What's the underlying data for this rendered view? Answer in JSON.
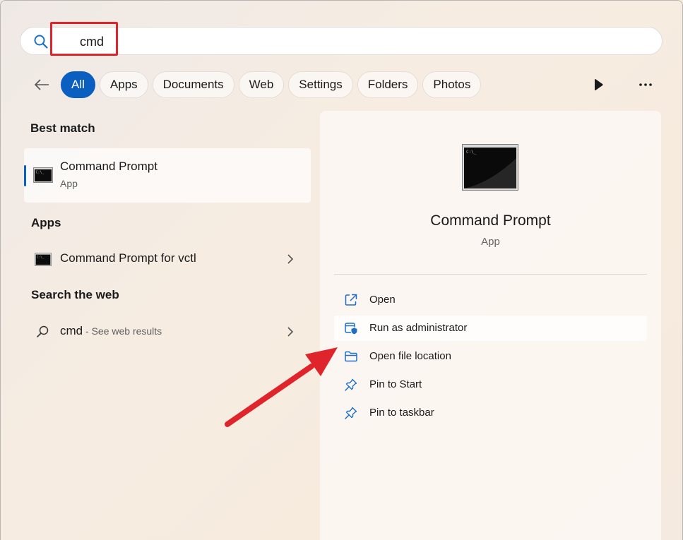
{
  "search": {
    "value": "cmd",
    "placeholder": ""
  },
  "filters": [
    {
      "label": "All",
      "active": true
    },
    {
      "label": "Apps",
      "active": false
    },
    {
      "label": "Documents",
      "active": false
    },
    {
      "label": "Web",
      "active": false
    },
    {
      "label": "Settings",
      "active": false
    },
    {
      "label": "Folders",
      "active": false
    },
    {
      "label": "Photos",
      "active": false
    }
  ],
  "best_match": {
    "heading": "Best match",
    "title": "Command Prompt",
    "subtitle": "App"
  },
  "apps": {
    "heading": "Apps",
    "items": [
      {
        "label": "Command Prompt for vctl"
      }
    ]
  },
  "web": {
    "heading": "Search the web",
    "query": "cmd",
    "hint": " - See web results"
  },
  "preview": {
    "title": "Command Prompt",
    "subtitle": "App",
    "actions": [
      {
        "label": "Open",
        "icon": "open-external-icon"
      },
      {
        "label": "Run as administrator",
        "icon": "shield-admin-icon"
      },
      {
        "label": "Open file location",
        "icon": "folder-icon"
      },
      {
        "label": "Pin to Start",
        "icon": "pin-icon"
      },
      {
        "label": "Pin to taskbar",
        "icon": "pin-icon"
      }
    ]
  },
  "colors": {
    "accent": "#0a5fc0",
    "annotation_red": "#e0242b",
    "icon_blue": "#1f6fc5"
  }
}
